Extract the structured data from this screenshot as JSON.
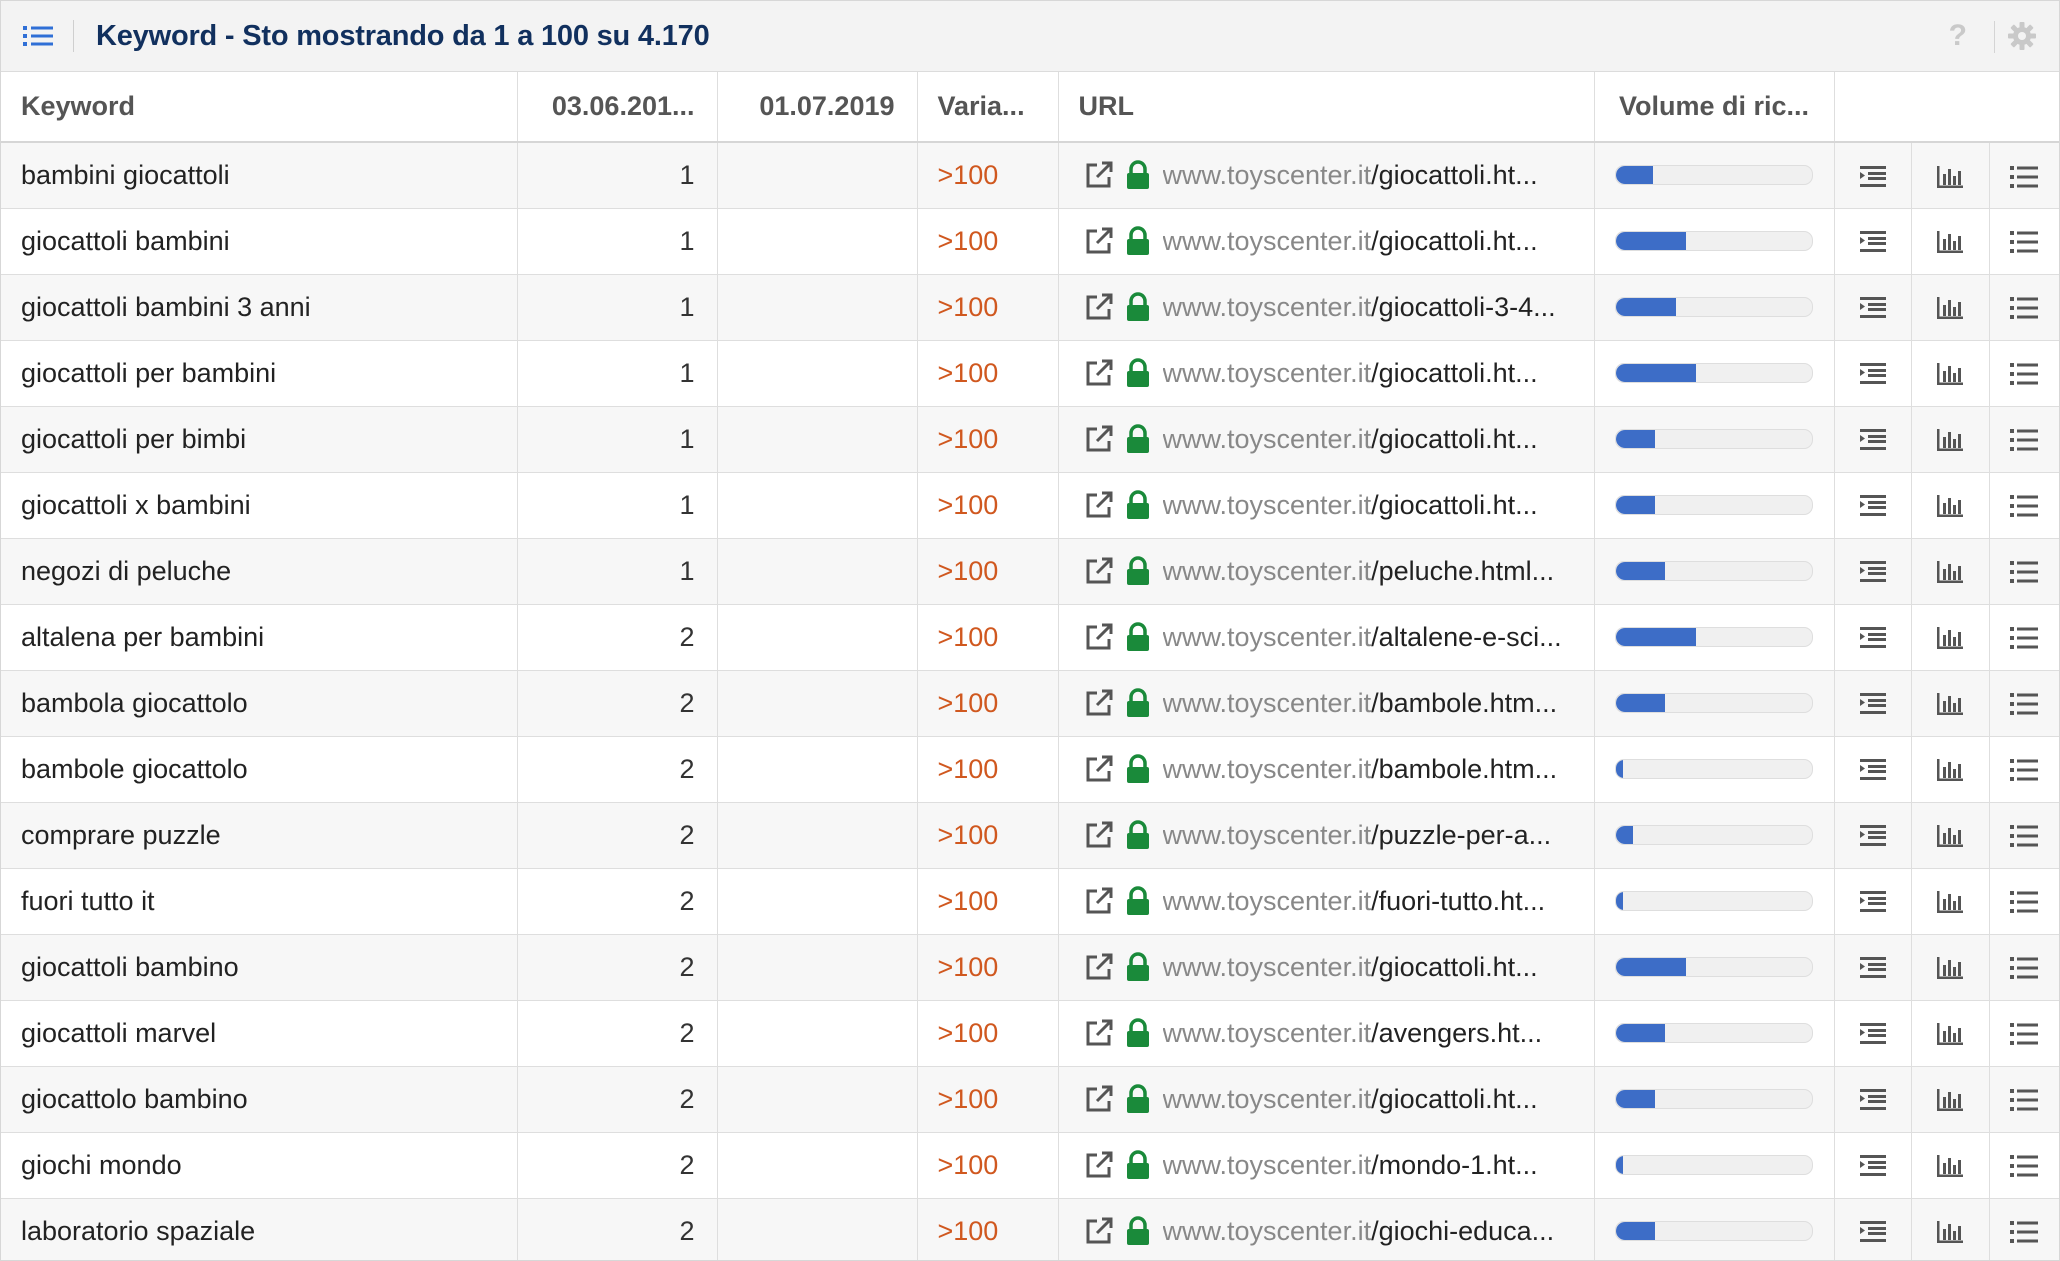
{
  "header": {
    "title": "Keyword - Sto mostrando da 1 a 100 su 4.170",
    "help": "?"
  },
  "columns": {
    "keyword": "Keyword",
    "date1": "03.06.201...",
    "date2": "01.07.2019",
    "variation": "Varia...",
    "url": "URL",
    "volume": "Volume di ric..."
  },
  "colors": {
    "accent": "#3d6dc7",
    "variation": "#d0581f",
    "lock": "#1a8a3a",
    "title": "#11305e"
  },
  "rows": [
    {
      "keyword": "bambini giocattoli",
      "pos": "1",
      "var": ">100",
      "domain": "www.toyscenter.it",
      "path": "/giocattoli.ht...",
      "volume": 0.19
    },
    {
      "keyword": "giocattoli bambini",
      "pos": "1",
      "var": ">100",
      "domain": "www.toyscenter.it",
      "path": "/giocattoli.ht...",
      "volume": 0.36
    },
    {
      "keyword": "giocattoli bambini 3 anni",
      "pos": "1",
      "var": ">100",
      "domain": "www.toyscenter.it",
      "path": "/giocattoli-3-4...",
      "volume": 0.31
    },
    {
      "keyword": "giocattoli per bambini",
      "pos": "1",
      "var": ">100",
      "domain": "www.toyscenter.it",
      "path": "/giocattoli.ht...",
      "volume": 0.41
    },
    {
      "keyword": "giocattoli per bimbi",
      "pos": "1",
      "var": ">100",
      "domain": "www.toyscenter.it",
      "path": "/giocattoli.ht...",
      "volume": 0.2
    },
    {
      "keyword": "giocattoli x bambini",
      "pos": "1",
      "var": ">100",
      "domain": "www.toyscenter.it",
      "path": "/giocattoli.ht...",
      "volume": 0.2
    },
    {
      "keyword": "negozi di peluche",
      "pos": "1",
      "var": ">100",
      "domain": "www.toyscenter.it",
      "path": "/peluche.html...",
      "volume": 0.25
    },
    {
      "keyword": "altalena per bambini",
      "pos": "2",
      "var": ">100",
      "domain": "www.toyscenter.it",
      "path": "/altalene-e-sci...",
      "volume": 0.41
    },
    {
      "keyword": "bambola giocattolo",
      "pos": "2",
      "var": ">100",
      "domain": "www.toyscenter.it",
      "path": "/bambole.htm...",
      "volume": 0.25
    },
    {
      "keyword": "bambole giocattolo",
      "pos": "2",
      "var": ">100",
      "domain": "www.toyscenter.it",
      "path": "/bambole.htm...",
      "volume": 0.04
    },
    {
      "keyword": "comprare puzzle",
      "pos": "2",
      "var": ">100",
      "domain": "www.toyscenter.it",
      "path": "/puzzle-per-a...",
      "volume": 0.09
    },
    {
      "keyword": "fuori tutto it",
      "pos": "2",
      "var": ">100",
      "domain": "www.toyscenter.it",
      "path": "/fuori-tutto.ht...",
      "volume": 0.04
    },
    {
      "keyword": "giocattoli bambino",
      "pos": "2",
      "var": ">100",
      "domain": "www.toyscenter.it",
      "path": "/giocattoli.ht...",
      "volume": 0.36
    },
    {
      "keyword": "giocattoli marvel",
      "pos": "2",
      "var": ">100",
      "domain": "www.toyscenter.it",
      "path": "/avengers.ht...",
      "volume": 0.25
    },
    {
      "keyword": "giocattolo bambino",
      "pos": "2",
      "var": ">100",
      "domain": "www.toyscenter.it",
      "path": "/giocattoli.ht...",
      "volume": 0.2
    },
    {
      "keyword": "giochi mondo",
      "pos": "2",
      "var": ">100",
      "domain": "www.toyscenter.it",
      "path": "/mondo-1.ht...",
      "volume": 0.04
    },
    {
      "keyword": "laboratorio spaziale",
      "pos": "2",
      "var": ">100",
      "domain": "www.toyscenter.it",
      "path": "/giochi-educa...",
      "volume": 0.2
    }
  ]
}
